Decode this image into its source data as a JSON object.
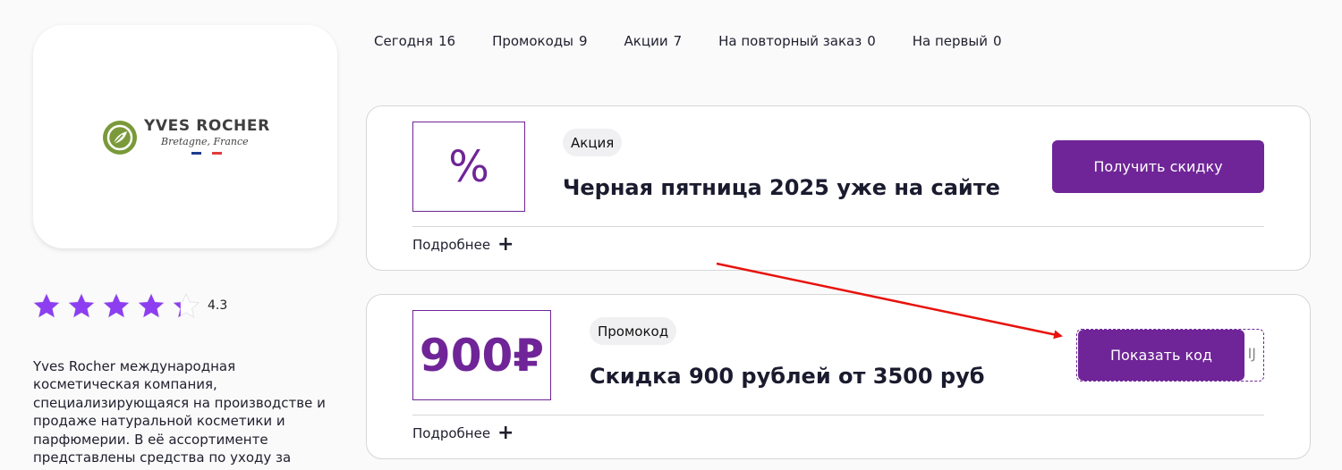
{
  "brand": {
    "name": "YVES ROCHER",
    "subtitle": "Bretagne, France",
    "logo_color": "#7a9a3a",
    "rating": 4.3,
    "rating_text": "4.3",
    "star_color": "#8c3ef0",
    "description": "Yves Rocher международная косметическая компания, специализирующаяся на производстве и продаже натуральной косметики и парфюмерии. В её ассортименте представлены средства по уходу за"
  },
  "tabs": [
    {
      "label": "Сегодня",
      "count": "16"
    },
    {
      "label": "Промокоды",
      "count": "9"
    },
    {
      "label": "Акции",
      "count": "7"
    },
    {
      "label": "На повторный заказ",
      "count": "0"
    },
    {
      "label": "На первый",
      "count": "0"
    }
  ],
  "offers": [
    {
      "badge": "%",
      "type": "Акция",
      "title": "Черная пятница 2025 уже на сайте",
      "button": "Получить скидку",
      "more": "Подробнее",
      "more_icon": "plus-icon"
    },
    {
      "badge": "900₽",
      "type": "Промокод",
      "title": "Скидка 900 рублей от 3500 руб",
      "button": "Показать код",
      "code_peek": "IJ",
      "more": "Подробнее",
      "more_icon": "plus-icon"
    }
  ],
  "colors": {
    "accent": "#6f2597",
    "annotation_arrow": "#e8120c"
  }
}
